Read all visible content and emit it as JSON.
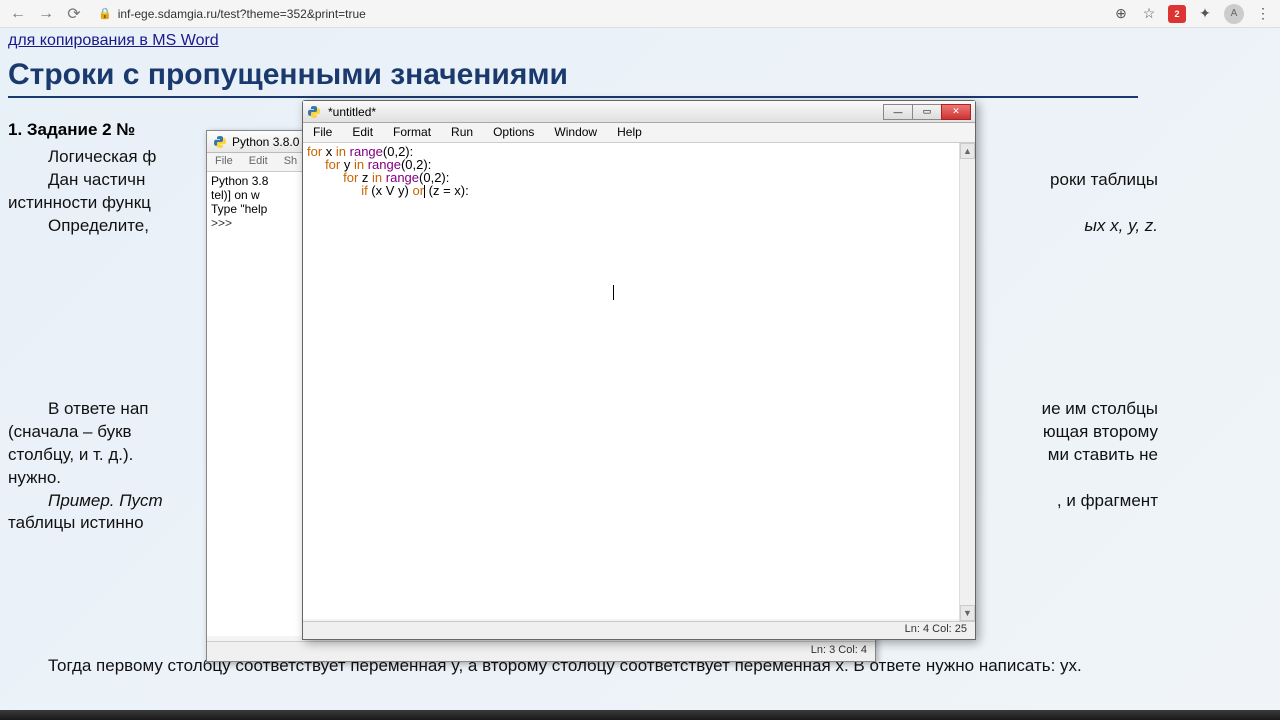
{
  "browser": {
    "url": "inf-ege.sdamgia.ru/test?theme=352&print=true",
    "badge": "2",
    "avatar": "A"
  },
  "page": {
    "top_link": "для копирования в MS Word",
    "h1": "Строки с пропущенными значениями",
    "task_head": "1. Задание 2 №",
    "para1_l1": "Логическая ф",
    "para1_l2": "Дан  частичн",
    "para1_l2_right": "роки  таблицы",
    "para1_l3": "истинности функц",
    "para1_l4": "Определите,",
    "para1_l4_right": "ых x, y, z.",
    "para2_l1": "В ответе нап",
    "para2_l1_right": "ие им столбцы",
    "para2_l2": "(сначала – букв",
    "para2_l2_right": "ющая второму",
    "para2_l3": "столбцу, и т. д.).",
    "para2_l3_right": "ми ставить не",
    "para2_l4": "нужно.",
    "para2_l5": "Пример. Пуст",
    "para2_l5_right": ", и фрагмент",
    "para2_l6": "таблицы истинно",
    "para3": "Тогда первому столбцу соответствует переменная y, а второму столбцу соответствует переменная x. В ответе нужно написать: yx."
  },
  "shell": {
    "title": "Python 3.8.0",
    "menu": {
      "file": "File",
      "edit": "Edit",
      "shell": "Sh"
    },
    "line1": "Python 3.8",
    "line2": "tel)] on w",
    "line3": "Type \"help",
    "prompt": ">>>",
    "status": "Ln: 3   Col: 4"
  },
  "editor": {
    "title": "*untitled*",
    "menu": {
      "file": "File",
      "edit": "Edit",
      "format": "Format",
      "run": "Run",
      "options": "Options",
      "window": "Window",
      "help": "Help"
    },
    "code": {
      "l1": {
        "kw1": "for",
        "v": " x ",
        "kw2": "in",
        "fn": " range",
        "args": "(0,2):"
      },
      "l2": {
        "pad": "     ",
        "kw1": "for",
        "v": " y ",
        "kw2": "in",
        "fn": " range",
        "args": "(0,2):"
      },
      "l3": {
        "pad": "          ",
        "kw1": "for",
        "v": " z ",
        "kw2": "in",
        "fn": " range",
        "args": "(0,2):"
      },
      "l4": {
        "pad": "               ",
        "kw1": "if",
        "expr1": " (x V y) ",
        "kw2": "or",
        "expr2": " (z = x):"
      }
    },
    "status": "Ln: 4   Col: 25"
  }
}
